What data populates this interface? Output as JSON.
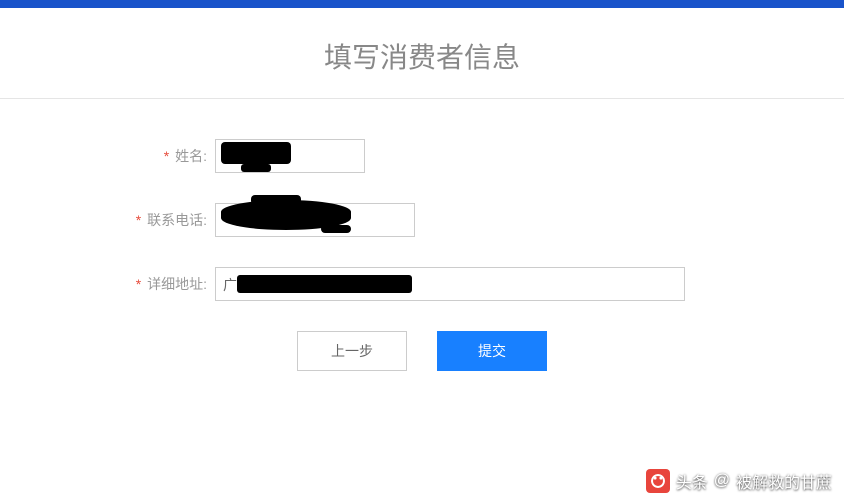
{
  "title": "填写消费者信息",
  "form": {
    "required_mark": "*",
    "name_label": "姓名:",
    "name_value": "",
    "phone_label": "联系电话:",
    "phone_value": "",
    "address_label": "详细地址:",
    "address_value": "",
    "address_prefix": "广"
  },
  "buttons": {
    "prev": "上一步",
    "submit": "提交"
  },
  "watermark": {
    "brand": "头条",
    "at": "@",
    "author": "被解救的甘蔗"
  }
}
